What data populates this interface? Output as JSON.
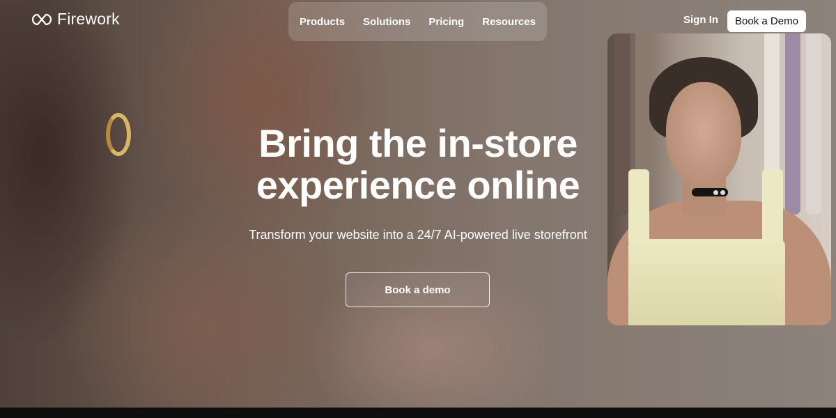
{
  "brand": {
    "name": "Firework"
  },
  "nav": {
    "items": [
      {
        "label": "Products"
      },
      {
        "label": "Solutions"
      },
      {
        "label": "Pricing"
      },
      {
        "label": "Resources"
      }
    ],
    "sign_in": "Sign In",
    "book_demo": "Book a Demo"
  },
  "hero": {
    "headline_line1": "Bring the in-store",
    "headline_line2": "experience online",
    "subheadline": "Transform your website into a 24/7 AI-powered live storefront",
    "cta": "Book a demo"
  },
  "colors": {
    "primary_text": "#ffffff",
    "button_bg": "#ffffff",
    "button_text": "#111111"
  },
  "icons": [
    "firework-logo-icon"
  ]
}
